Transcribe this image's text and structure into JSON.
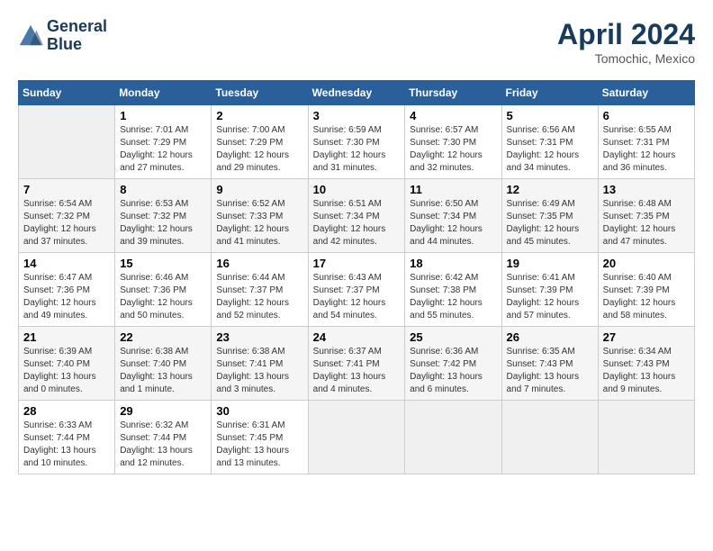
{
  "header": {
    "logo_line1": "General",
    "logo_line2": "Blue",
    "month": "April 2024",
    "location": "Tomochic, Mexico"
  },
  "weekdays": [
    "Sunday",
    "Monday",
    "Tuesday",
    "Wednesday",
    "Thursday",
    "Friday",
    "Saturday"
  ],
  "weeks": [
    [
      {
        "day": "",
        "info": ""
      },
      {
        "day": "1",
        "info": "Sunrise: 7:01 AM\nSunset: 7:29 PM\nDaylight: 12 hours\nand 27 minutes."
      },
      {
        "day": "2",
        "info": "Sunrise: 7:00 AM\nSunset: 7:29 PM\nDaylight: 12 hours\nand 29 minutes."
      },
      {
        "day": "3",
        "info": "Sunrise: 6:59 AM\nSunset: 7:30 PM\nDaylight: 12 hours\nand 31 minutes."
      },
      {
        "day": "4",
        "info": "Sunrise: 6:57 AM\nSunset: 7:30 PM\nDaylight: 12 hours\nand 32 minutes."
      },
      {
        "day": "5",
        "info": "Sunrise: 6:56 AM\nSunset: 7:31 PM\nDaylight: 12 hours\nand 34 minutes."
      },
      {
        "day": "6",
        "info": "Sunrise: 6:55 AM\nSunset: 7:31 PM\nDaylight: 12 hours\nand 36 minutes."
      }
    ],
    [
      {
        "day": "7",
        "info": "Sunrise: 6:54 AM\nSunset: 7:32 PM\nDaylight: 12 hours\nand 37 minutes."
      },
      {
        "day": "8",
        "info": "Sunrise: 6:53 AM\nSunset: 7:32 PM\nDaylight: 12 hours\nand 39 minutes."
      },
      {
        "day": "9",
        "info": "Sunrise: 6:52 AM\nSunset: 7:33 PM\nDaylight: 12 hours\nand 41 minutes."
      },
      {
        "day": "10",
        "info": "Sunrise: 6:51 AM\nSunset: 7:34 PM\nDaylight: 12 hours\nand 42 minutes."
      },
      {
        "day": "11",
        "info": "Sunrise: 6:50 AM\nSunset: 7:34 PM\nDaylight: 12 hours\nand 44 minutes."
      },
      {
        "day": "12",
        "info": "Sunrise: 6:49 AM\nSunset: 7:35 PM\nDaylight: 12 hours\nand 45 minutes."
      },
      {
        "day": "13",
        "info": "Sunrise: 6:48 AM\nSunset: 7:35 PM\nDaylight: 12 hours\nand 47 minutes."
      }
    ],
    [
      {
        "day": "14",
        "info": "Sunrise: 6:47 AM\nSunset: 7:36 PM\nDaylight: 12 hours\nand 49 minutes."
      },
      {
        "day": "15",
        "info": "Sunrise: 6:46 AM\nSunset: 7:36 PM\nDaylight: 12 hours\nand 50 minutes."
      },
      {
        "day": "16",
        "info": "Sunrise: 6:44 AM\nSunset: 7:37 PM\nDaylight: 12 hours\nand 52 minutes."
      },
      {
        "day": "17",
        "info": "Sunrise: 6:43 AM\nSunset: 7:37 PM\nDaylight: 12 hours\nand 54 minutes."
      },
      {
        "day": "18",
        "info": "Sunrise: 6:42 AM\nSunset: 7:38 PM\nDaylight: 12 hours\nand 55 minutes."
      },
      {
        "day": "19",
        "info": "Sunrise: 6:41 AM\nSunset: 7:39 PM\nDaylight: 12 hours\nand 57 minutes."
      },
      {
        "day": "20",
        "info": "Sunrise: 6:40 AM\nSunset: 7:39 PM\nDaylight: 12 hours\nand 58 minutes."
      }
    ],
    [
      {
        "day": "21",
        "info": "Sunrise: 6:39 AM\nSunset: 7:40 PM\nDaylight: 13 hours\nand 0 minutes."
      },
      {
        "day": "22",
        "info": "Sunrise: 6:38 AM\nSunset: 7:40 PM\nDaylight: 13 hours\nand 1 minute."
      },
      {
        "day": "23",
        "info": "Sunrise: 6:38 AM\nSunset: 7:41 PM\nDaylight: 13 hours\nand 3 minutes."
      },
      {
        "day": "24",
        "info": "Sunrise: 6:37 AM\nSunset: 7:41 PM\nDaylight: 13 hours\nand 4 minutes."
      },
      {
        "day": "25",
        "info": "Sunrise: 6:36 AM\nSunset: 7:42 PM\nDaylight: 13 hours\nand 6 minutes."
      },
      {
        "day": "26",
        "info": "Sunrise: 6:35 AM\nSunset: 7:43 PM\nDaylight: 13 hours\nand 7 minutes."
      },
      {
        "day": "27",
        "info": "Sunrise: 6:34 AM\nSunset: 7:43 PM\nDaylight: 13 hours\nand 9 minutes."
      }
    ],
    [
      {
        "day": "28",
        "info": "Sunrise: 6:33 AM\nSunset: 7:44 PM\nDaylight: 13 hours\nand 10 minutes."
      },
      {
        "day": "29",
        "info": "Sunrise: 6:32 AM\nSunset: 7:44 PM\nDaylight: 13 hours\nand 12 minutes."
      },
      {
        "day": "30",
        "info": "Sunrise: 6:31 AM\nSunset: 7:45 PM\nDaylight: 13 hours\nand 13 minutes."
      },
      {
        "day": "",
        "info": ""
      },
      {
        "day": "",
        "info": ""
      },
      {
        "day": "",
        "info": ""
      },
      {
        "day": "",
        "info": ""
      }
    ]
  ]
}
